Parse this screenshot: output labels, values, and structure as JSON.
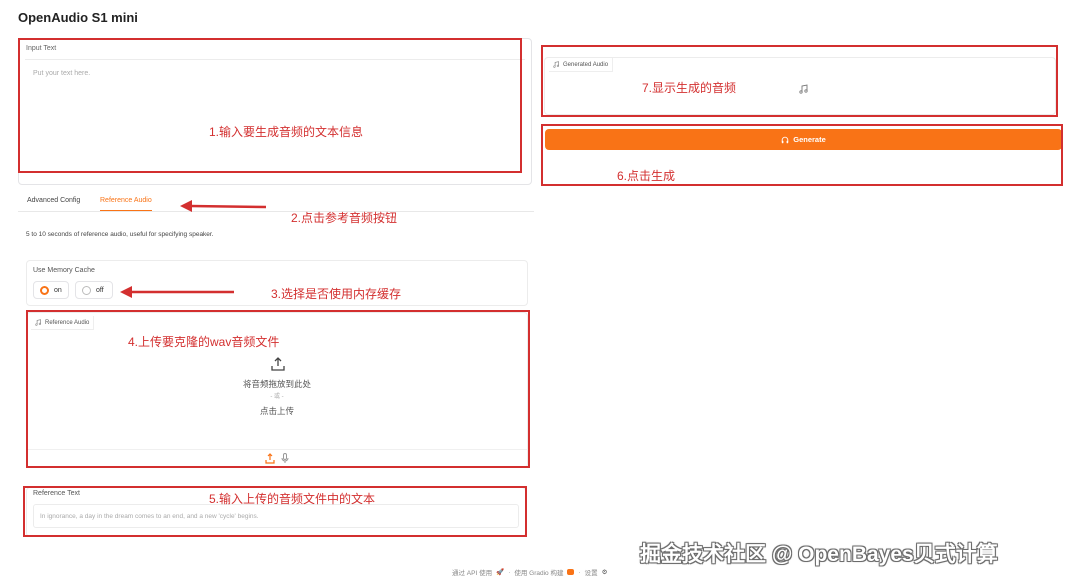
{
  "app": {
    "title": "OpenAudio S1 mini"
  },
  "input_text": {
    "label": "Input Text",
    "placeholder": "Put your text here."
  },
  "tabs": [
    {
      "label": "Advanced Config"
    },
    {
      "label": "Reference Audio",
      "active": true
    }
  ],
  "reference": {
    "description": "5 to 10 seconds of reference audio, useful for specifying speaker.",
    "memory_cache": {
      "label": "Use Memory Cache",
      "options": [
        "on",
        "off"
      ],
      "selected": "on"
    },
    "audio": {
      "label": "Reference Audio",
      "drop_text": "将音频拖放到此处",
      "or_text": "- 或 -",
      "click_text": "点击上传"
    },
    "text": {
      "label": "Reference Text",
      "placeholder": "In ignorance, a day in the dream comes to an end, and a new 'cycle' begins."
    }
  },
  "generated_audio": {
    "label": "Generated Audio"
  },
  "generate_button": {
    "label": "Generate"
  },
  "annotations": {
    "a1": "1.输入要生成音频的文本信息",
    "a2": "2.点击参考音频按钮",
    "a3": "3.选择是否使用内存缓存",
    "a4": "4.上传要克隆的wav音频文件",
    "a5": "5.输入上传的音频文件中的文本",
    "a6": "6.点击生成",
    "a7": "7.显示生成的音频"
  },
  "footer": {
    "api": "通过 API 使用",
    "sep1": "·",
    "gradio": "使用 Gradio 构建",
    "sep2": "·",
    "settings": "设置"
  },
  "watermark": "掘金技术社区 @ OpenBayes贝式计算",
  "colors": {
    "accent": "#f97316",
    "annotation": "#d32f2f"
  }
}
